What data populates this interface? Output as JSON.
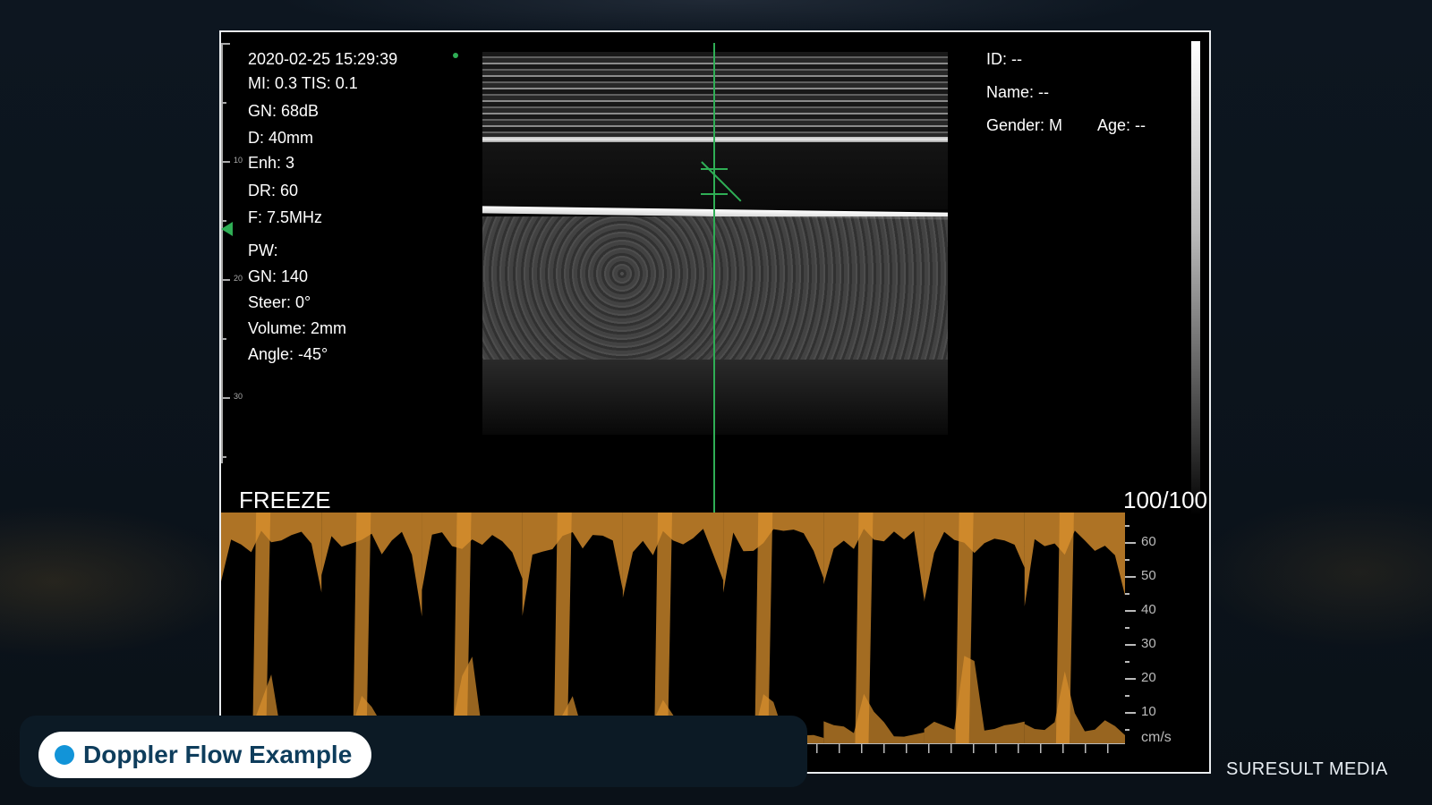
{
  "ultrasound": {
    "datetime": "2020-02-25 15:29:39",
    "mi_tis": "MI: 0.3   TIS: 0.1",
    "gain": "GN: 68dB",
    "depth": "D: 40mm",
    "enhance": "Enh: 3",
    "dynamic_range": "DR: 60",
    "frequency": "F: 7.5MHz",
    "mode": "PW:",
    "pw_gain": "GN: 140",
    "steer": "Steer: 0°",
    "volume": "Volume: 2mm",
    "angle": "Angle: -45°",
    "status": "FREEZE",
    "frame_count": "100/100",
    "depth_ticks": [
      "10",
      "20",
      "30"
    ],
    "cursor_color": "#2fae55"
  },
  "patient": {
    "id": "ID: --",
    "name": "Name: --",
    "gender": "Gender: M",
    "age": "Age: --"
  },
  "doppler": {
    "velocity_labels": [
      "60",
      "50",
      "40",
      "30",
      "20",
      "10"
    ],
    "unit": "cm/s",
    "spectrum_color": "#d9902e",
    "cycles": 9
  },
  "caption": {
    "label": "Doppler Flow Example",
    "dot_color": "#1294d8"
  },
  "watermark": "SURESULT MEDIA"
}
